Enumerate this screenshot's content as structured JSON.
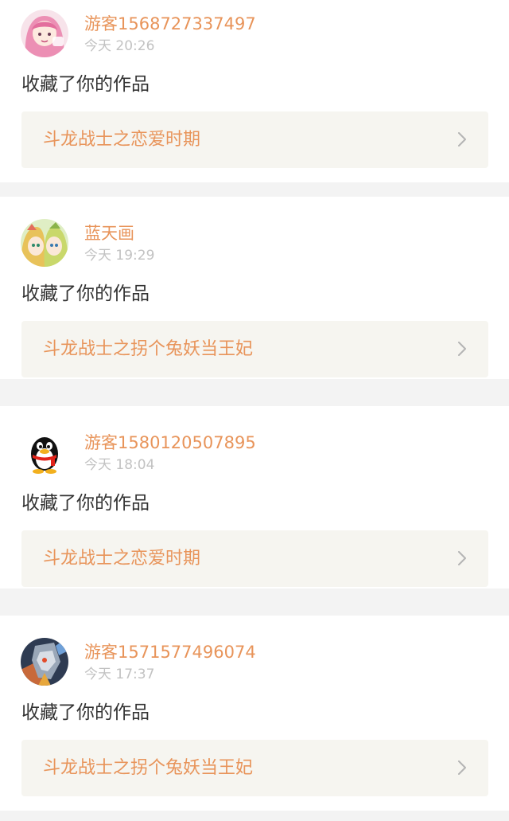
{
  "notifications": [
    {
      "username": "游客1568727337497",
      "time": "今天 20:26",
      "action": "收藏了你的作品",
      "work_title": "斗龙战士之恋爱时期",
      "avatar_icon": "anime-pink-hair-avatar-icon"
    },
    {
      "username": "蓝天画",
      "time": "今天 19:29",
      "action": "收藏了你的作品",
      "work_title": "斗龙战士之拐个兔妖当王妃",
      "avatar_icon": "anime-girls-avatar-icon"
    },
    {
      "username": "游客1580120507895",
      "time": "今天 18:04",
      "action": "收藏了你的作品",
      "work_title": "斗龙战士之恋爱时期",
      "avatar_icon": "qq-penguin-avatar-icon"
    },
    {
      "username": "游客1571577496074",
      "time": "今天 17:37",
      "action": "收藏了你的作品",
      "work_title": "斗龙战士之拐个兔妖当王妃",
      "avatar_icon": "game-hero-avatar-icon"
    }
  ],
  "colors": {
    "accent": "#e8945a",
    "time_text": "#c2c2c2",
    "body_text": "#333333",
    "link_background": "#f6f5f0",
    "page_background": "#f3f3f3"
  }
}
